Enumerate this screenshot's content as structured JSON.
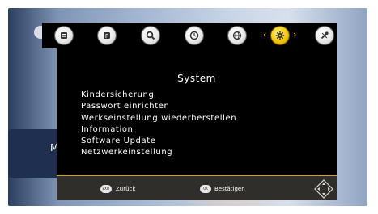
{
  "background": {
    "overlay_letter": "M"
  },
  "top_menu": {
    "icons": [
      {
        "name": "epg-icon",
        "active": false
      },
      {
        "name": "picture-icon",
        "active": false
      },
      {
        "name": "search-icon",
        "active": false
      },
      {
        "name": "timer-clock-icon",
        "active": false
      },
      {
        "name": "globe-network-icon",
        "active": false
      },
      {
        "name": "settings-gear-icon",
        "active": true
      },
      {
        "name": "tools-icon",
        "active": false
      }
    ],
    "prev_arrow": "‹",
    "next_arrow": "›"
  },
  "system_menu": {
    "title": "System",
    "items": [
      "Kindersicherung",
      "Passwort einrichten",
      "Werkseinstellung wiederherstellen",
      "Information",
      "Software Update",
      "Netzwerkeinstellung"
    ]
  },
  "footer": {
    "back_key": "EXIT",
    "back_label": "Zurück",
    "ok_key": "OK",
    "ok_label": "Bestätigen"
  },
  "colors": {
    "accent": "#f2c200",
    "panel": "#000000",
    "footer": "#2f2e2b",
    "text": "#ffffff"
  }
}
